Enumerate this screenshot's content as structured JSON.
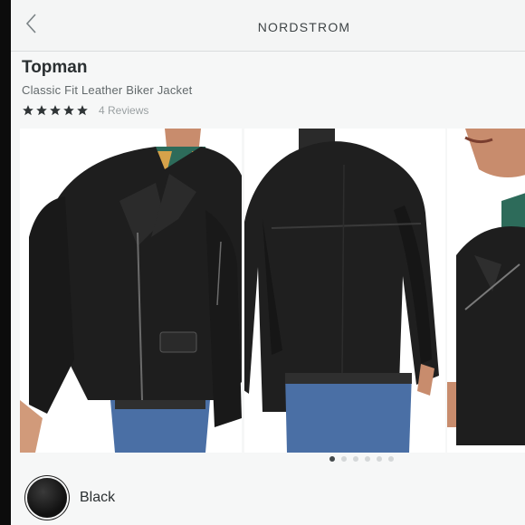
{
  "header": {
    "brand": "NORDSTROM",
    "back_icon": "chevron-left-icon"
  },
  "product": {
    "brand": "Topman",
    "name": "Classic Fit Leather Biker Jacket",
    "rating": 5,
    "reviews_label": "4 Reviews"
  },
  "gallery": {
    "images": [
      "jacket-front-view",
      "jacket-back-view",
      "jacket-side-view"
    ],
    "dots_count": 6,
    "active_dot": 1
  },
  "color": {
    "selected": "Black",
    "swatch": "#111111"
  },
  "colors": {
    "accent": "#2a2f31",
    "background": "#f6f7f7"
  }
}
